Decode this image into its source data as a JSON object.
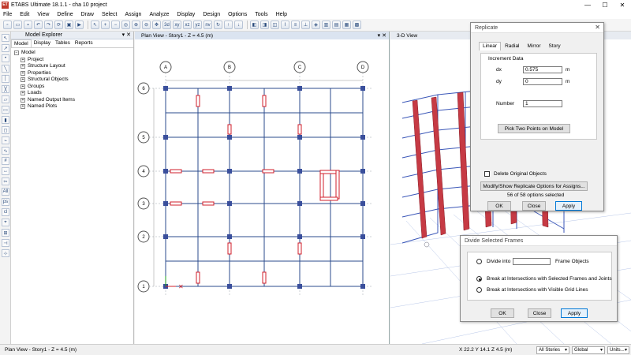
{
  "app": {
    "title": "ETABS Ultimate 18.1.1 - cha 10 project",
    "icon_text": "ET"
  },
  "menu": [
    "File",
    "Edit",
    "View",
    "Define",
    "Draw",
    "Select",
    "Assign",
    "Analyze",
    "Display",
    "Design",
    "Options",
    "Tools",
    "Help"
  ],
  "toolbar": {
    "icons": [
      "new-file-icon",
      "open-icon",
      "save-icon",
      "undo-icon",
      "redo-icon",
      "refresh-icon",
      "lock-icon",
      "run-icon",
      "pointer-icon",
      "zoom-in-icon",
      "zoom-out-icon",
      "zoom-fit-icon",
      "zoom-window-icon",
      "zoom-previous-icon",
      "pan-icon",
      "set-3d-view-icon",
      "plan-view-icon",
      "elevation-view-icon",
      "rotate-icon",
      "perspective-icon",
      "up-icon",
      "down-icon"
    ],
    "labels": [
      "3d",
      "xy",
      "xz",
      "yz",
      "nv"
    ]
  },
  "explorer": {
    "title": "Model Explorer",
    "tabs": [
      "Model",
      "Display",
      "Tables",
      "Reports"
    ],
    "active_tab": "Model",
    "root": "Model",
    "items": [
      "Project",
      "Structure Layout",
      "Properties",
      "Structural Objects",
      "Groups",
      "Loads",
      "Named Output Items",
      "Named Plots"
    ]
  },
  "plan_view": {
    "title": "Plan View - Story1 - Z = 4.5 (m)",
    "grid_cols": [
      "A",
      "B",
      "C",
      "D"
    ],
    "grid_rows": [
      "6",
      "5",
      "4",
      "3",
      "2",
      "1"
    ],
    "colors": {
      "beam": "#2b4b8c",
      "column": "#3a4f9c",
      "wall": "#d21f2b",
      "axis_x": "#d21f2b",
      "axis_y": "#1ea01e"
    }
  },
  "view3d": {
    "title": "3-D View"
  },
  "replicate": {
    "title": "Replicate",
    "tabs": [
      "Linear",
      "Radial",
      "Mirror",
      "Story"
    ],
    "active_tab": "Linear",
    "group_label": "Increment Data",
    "dx_label": "dx",
    "dx_value": "0.575",
    "dx_unit": "m",
    "dy_label": "dy",
    "dy_value": "0",
    "dy_unit": "m",
    "number_label": "Number",
    "number_value": "1",
    "pick_button": "Pick Two Points on Model",
    "delete_label": "Delete Original Objects",
    "modify_button": "Modify/Show Replicate Options for Assigns...",
    "options_status": "56 of 58 options selected",
    "ok": "OK",
    "close": "Close",
    "apply": "Apply"
  },
  "divide": {
    "title": "Divide Selected Frames",
    "opt1_label": "Divide into",
    "opt1_suffix": "Frame Objects",
    "opt1_value": "",
    "opt2_label": "Break at Intersections with Selected Frames and Joints",
    "opt3_label": "Break at Intersections with Visible Grid Lines",
    "selected_option": 2,
    "ok": "OK",
    "close": "Close",
    "apply": "Apply"
  },
  "status": {
    "left": "Plan View - Story1 - Z = 4.5 (m)",
    "coords": "X 22.2  Y 14.1  Z 4.5 (m)",
    "stories": "All Stories",
    "coord_sys": "Global",
    "units": "Units..."
  }
}
